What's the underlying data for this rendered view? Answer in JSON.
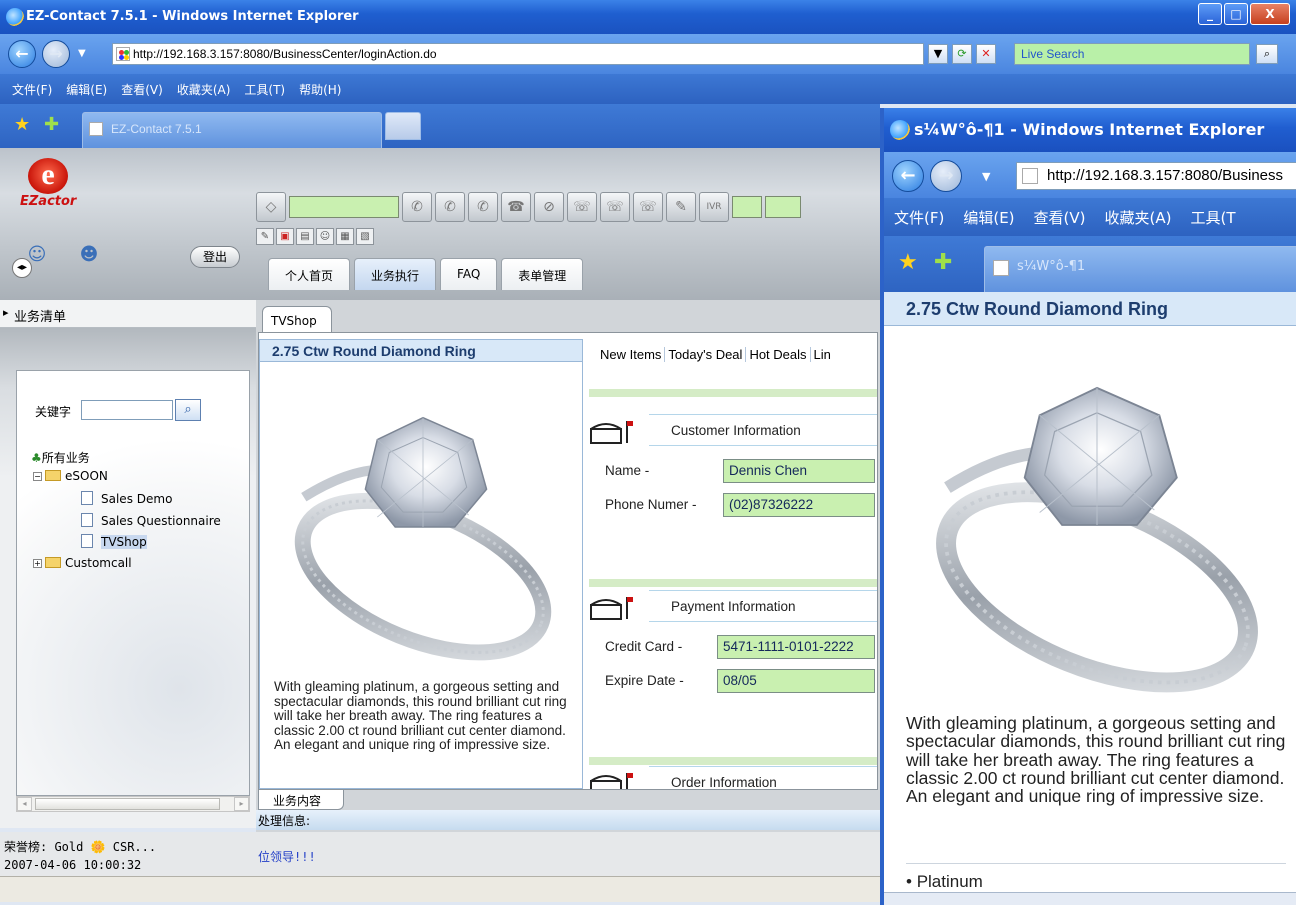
{
  "main_window": {
    "title": "EZ-Contact 7.5.1 - Windows Internet Explorer",
    "url": "http://192.168.3.157:8080/BusinessCenter/loginAction.do",
    "search_placeholder": "Live Search",
    "menu": [
      "文件(F)",
      "编辑(E)",
      "查看(V)",
      "收藏夹(A)",
      "工具(T)",
      "帮助(H)"
    ],
    "tab_title": "EZ-Contact 7.5.1"
  },
  "app": {
    "logo_text": "EZactor",
    "logout_label": "登出",
    "main_tabs": [
      {
        "label": "个人首页"
      },
      {
        "label": "业务执行"
      },
      {
        "label": "FAQ"
      },
      {
        "label": "表单管理"
      }
    ],
    "sidebar_title": "业务清单",
    "keyword_label": "关键字",
    "tree": {
      "root": "所有业务",
      "group1": "eSOON",
      "items": [
        "Sales Demo",
        "Sales Questionnaire",
        "TVShop"
      ],
      "group2": "Customcall"
    },
    "honor_line": "荣誉榜: Gold 🌼 CSR...",
    "honor_time": "2007-04-06 10:00:32",
    "lead_text": "位领导!!!",
    "content_tab": "TVShop",
    "biz_tab": "业务内容",
    "process_label": "处理信息:"
  },
  "product": {
    "title": "2.75 Ctw Round Diamond Ring",
    "description": "With gleaming platinum, a gorgeous setting and spectacular diamonds, this round brilliant cut ring will take her breath away. The ring features a classic 2.00 ct round brilliant cut center diamond. An elegant and unique ring of impressive size.",
    "bullet": "Platinum"
  },
  "links": [
    "New Items",
    "Today's Deal",
    "Hot Deals",
    "Lin"
  ],
  "customer": {
    "section": "Customer Information",
    "name_label": "Name -",
    "name_value": "Dennis Chen",
    "phone_label": "Phone Numer -",
    "phone_value": "(02)87326222"
  },
  "payment": {
    "section": "Payment Information",
    "card_label": "Credit Card -",
    "card_value": "5471-1111-0101-2222",
    "expire_label": "Expire Date -",
    "expire_value": "08/05"
  },
  "order": {
    "section": "Order Information"
  },
  "popup": {
    "title": "s¼W°ô-¶1 - Windows Internet Explorer",
    "url": "http://192.168.3.157:8080/Business",
    "menu": [
      "文件(F)",
      "编辑(E)",
      "查看(V)",
      "收藏夹(A)",
      "工具(T"
    ],
    "tab_title": "s¼W°ô-¶1"
  },
  "colors": {
    "field_green": "#c9f0b0",
    "title_blue": "#1d3d6e",
    "xp_blue": "#2a63d8"
  }
}
